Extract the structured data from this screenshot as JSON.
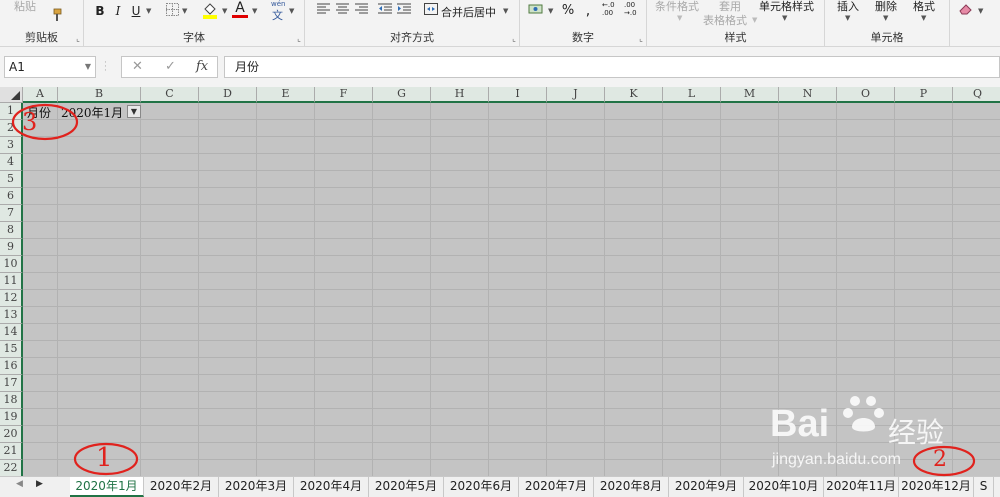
{
  "ribbon": {
    "clipboard": {
      "paste_label": "粘贴",
      "group_label": "剪贴板"
    },
    "font": {
      "bold": "B",
      "italic": "I",
      "underline": "U",
      "font_color_glyph": "A",
      "phonetic_top": "wén",
      "phonetic_bottom": "文",
      "group_label": "字体"
    },
    "alignment": {
      "merge_label": "合并后居中",
      "group_label": "对齐方式"
    },
    "number": {
      "percent": "%",
      "inc_decimal": "←.0\n.00",
      "dec_decimal": ".00\n→.0",
      "group_label": "数字"
    },
    "styles": {
      "conditional": "条件格式",
      "table_top": "套用",
      "table_bottom": "表格格式",
      "cell_styles": "单元格样式",
      "group_label": "样式"
    },
    "cells": {
      "insert": "插入",
      "delete": "删除",
      "format": "格式",
      "group_label": "单元格"
    }
  },
  "formula_bar": {
    "name_box": "A1",
    "fx": "fx",
    "content": "月份"
  },
  "grid": {
    "columns": [
      "A",
      "B",
      "C",
      "D",
      "E",
      "F",
      "G",
      "H",
      "I",
      "J",
      "K",
      "L",
      "M",
      "N",
      "O",
      "P",
      "Q"
    ],
    "rows": [
      "1",
      "2",
      "3",
      "4",
      "5",
      "6",
      "7",
      "8",
      "9",
      "10",
      "11",
      "12",
      "13",
      "14",
      "15",
      "16",
      "17",
      "18",
      "19",
      "20",
      "21",
      "22"
    ],
    "cells": {
      "A1": "月份",
      "B1": "2020年1月"
    }
  },
  "sheet_tabs": [
    "2020年1月",
    "2020年2月",
    "2020年3月",
    "2020年4月",
    "2020年5月",
    "2020年6月",
    "2020年7月",
    "2020年8月",
    "2020年9月",
    "2020年10月",
    "2020年11月",
    "2020年12月",
    "S"
  ],
  "active_tab": "2020年1月",
  "annotations": {
    "one": "1",
    "two": "2",
    "three": "3"
  },
  "watermark": {
    "logo_text": "Bai",
    "logo_suffix": "经验",
    "url": "jingyan.baidu.com"
  },
  "colors": {
    "accent": "#217346",
    "annotation": "#e0221d",
    "grid_bg": "#c4c4c4"
  }
}
